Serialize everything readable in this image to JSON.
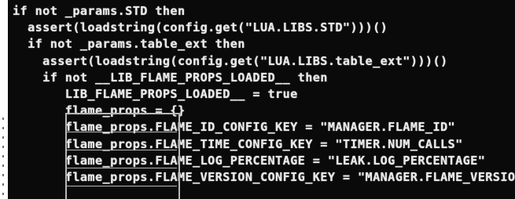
{
  "code_lines": [
    "if not _params.STD then",
    "  assert(loadstring(config.get(\"LUA.LIBS.STD\")))()",
    "  if not _params.table_ext then",
    "    assert(loadstring(config.get(\"LUA.LIBS.table_ext\")))()",
    "    if not __LIB_FLAME_PROPS_LOADED__ then",
    "       LIB_FLAME_PROPS_LOADED__ = true",
    "       flame_props = {}",
    "       flame_props.FLAME_ID_CONFIG_KEY = \"MANAGER.FLAME_ID\"",
    "       flame_props.FLAME_TIME_CONFIG_KEY = \"TIMER.NUM_CALLS\"",
    "       flame_props.FLAME_LOG_PERCENTAGE = \"LEAK.LOG_PERCENTAGE\"",
    "       flame_props.FLAME_VERSION_CONFIG_KEY = \"MANAGER.FLAME_VERSION\""
  ]
}
